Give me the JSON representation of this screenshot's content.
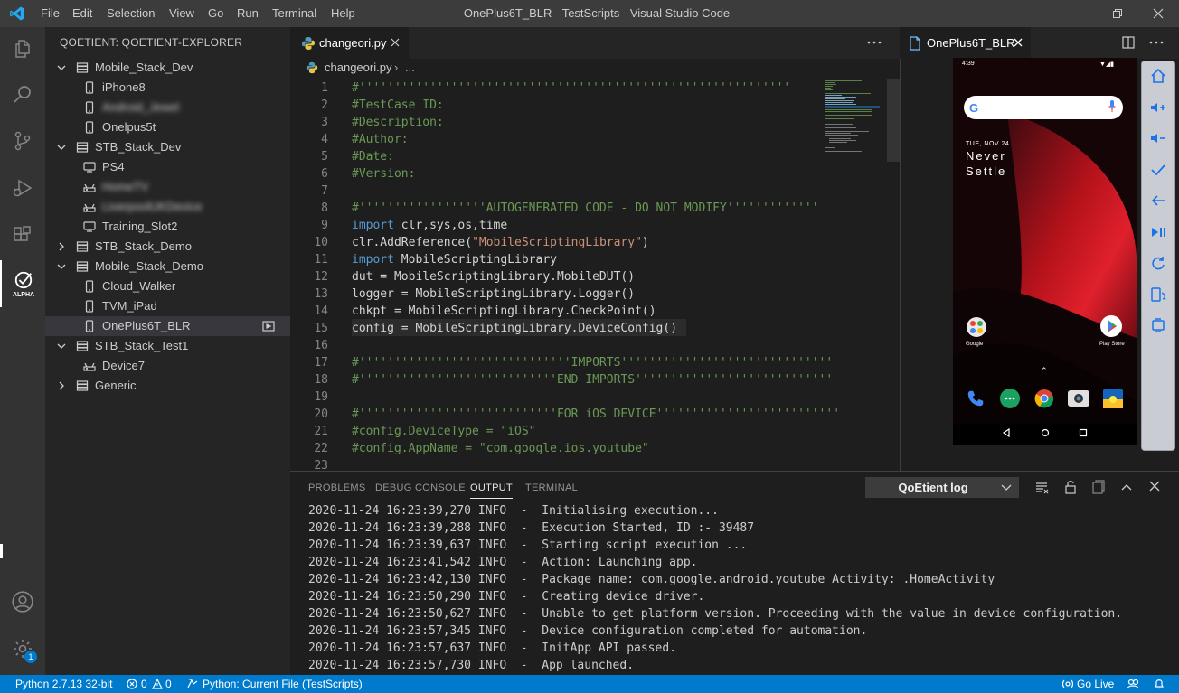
{
  "window": {
    "title": "OnePlus6T_BLR - TestScripts - Visual Studio Code",
    "menu": [
      "File",
      "Edit",
      "Selection",
      "View",
      "Go",
      "Run",
      "Terminal",
      "Help"
    ]
  },
  "activity": {
    "items": [
      "files-icon",
      "search-icon",
      "source-control-icon",
      "run-debug-icon",
      "extensions-icon",
      "qoetient-icon"
    ],
    "qoetient_badge": "ALPHA",
    "settings_badge": "1"
  },
  "sidebar": {
    "header": "QOETIENT: QOETIENT-EXPLORER",
    "tree": [
      {
        "label": "Mobile_Stack_Dev",
        "level": 0,
        "expanded": true,
        "icon": "server-icon"
      },
      {
        "label": "iPhone8",
        "level": 1,
        "icon": "phone-icon"
      },
      {
        "label": "Android_Jewel",
        "level": 1,
        "icon": "phone-icon",
        "blurred": true
      },
      {
        "label": "Onelpus5t",
        "level": 1,
        "icon": "phone-icon"
      },
      {
        "label": "STB_Stack_Dev",
        "level": 0,
        "expanded": true,
        "icon": "server-icon"
      },
      {
        "label": "PS4",
        "level": 1,
        "icon": "tv-icon"
      },
      {
        "label": "HomeTV",
        "level": 1,
        "icon": "router-icon",
        "blurred": true
      },
      {
        "label": "LiverpoolUKDevice",
        "level": 1,
        "icon": "router-icon",
        "blurred": true
      },
      {
        "label": "Training_Slot2",
        "level": 1,
        "icon": "tv-icon"
      },
      {
        "label": "STB_Stack_Demo",
        "level": 0,
        "expanded": false,
        "icon": "server-icon"
      },
      {
        "label": "Mobile_Stack_Demo",
        "level": 0,
        "expanded": true,
        "icon": "server-icon"
      },
      {
        "label": "Cloud_Walker",
        "level": 1,
        "icon": "phone-icon"
      },
      {
        "label": "TVM_iPad",
        "level": 1,
        "icon": "phone-icon"
      },
      {
        "label": "OnePlus6T_BLR",
        "level": 1,
        "icon": "phone-icon",
        "selected": true
      },
      {
        "label": "STB_Stack_Test1",
        "level": 0,
        "expanded": true,
        "icon": "server-icon"
      },
      {
        "label": "Device7",
        "level": 1,
        "icon": "router-icon"
      },
      {
        "label": "Generic",
        "level": 0,
        "expanded": false,
        "icon": "server-icon"
      }
    ]
  },
  "editor": {
    "tab_label": "changeori.py",
    "breadcrumb_file": "changeori.py",
    "breadcrumb_more": "...",
    "lines": [
      {
        "n": "1",
        "t": "#'''''''''''''''''''''''''''''''''''''''''''''''''''''''''''''",
        "k": "comment"
      },
      {
        "n": "2",
        "t": "#TestCase ID:",
        "k": "comment"
      },
      {
        "n": "3",
        "t": "#Description:",
        "k": "comment"
      },
      {
        "n": "4",
        "t": "#Author:",
        "k": "comment"
      },
      {
        "n": "5",
        "t": "#Date:",
        "k": "comment"
      },
      {
        "n": "6",
        "t": "#Version:",
        "k": "comment"
      },
      {
        "n": "7",
        "t": "",
        "k": "plain"
      },
      {
        "n": "8",
        "t": "#''''''''''''''''''AUTOGENERATED CODE - DO NOT MODIFY'''''''''''''",
        "k": "comment"
      },
      {
        "n": "9",
        "t": "import clr,sys,os,time",
        "k": "import"
      },
      {
        "n": "10",
        "t": "clr.AddReference(\"MobileScriptingLibrary\")",
        "k": "ref"
      },
      {
        "n": "11",
        "t": "import MobileScriptingLibrary",
        "k": "import"
      },
      {
        "n": "12",
        "t": "dut = MobileScriptingLibrary.MobileDUT()",
        "k": "plain"
      },
      {
        "n": "13",
        "t": "logger = MobileScriptingLibrary.Logger()",
        "k": "plain"
      },
      {
        "n": "14",
        "t": "chkpt = MobileScriptingLibrary.CheckPoint()",
        "k": "plain"
      },
      {
        "n": "15",
        "t": "config = MobileScriptingLibrary.DeviceConfig()",
        "k": "plain"
      },
      {
        "n": "16",
        "t": "",
        "k": "plain"
      },
      {
        "n": "17",
        "t": "#''''''''''''''''''''''''''''''IMPORTS''''''''''''''''''''''''''''''",
        "k": "comment"
      },
      {
        "n": "18",
        "t": "#''''''''''''''''''''''''''''END IMPORTS''''''''''''''''''''''''''''",
        "k": "comment"
      },
      {
        "n": "19",
        "t": "",
        "k": "plain"
      },
      {
        "n": "20",
        "t": "#''''''''''''''''''''''''''''FOR iOS DEVICE''''''''''''''''''''''''''",
        "k": "comment"
      },
      {
        "n": "21",
        "t": "#config.DeviceType = \"iOS\"",
        "k": "comment"
      },
      {
        "n": "22",
        "t": "#config.AppName = \"com.google.ios.youtube\"",
        "k": "comment"
      },
      {
        "n": "23",
        "t": "",
        "k": "plain"
      }
    ]
  },
  "device_panel": {
    "tab_label": "OnePlus6T_BLR",
    "phone": {
      "status_time": "4:39",
      "date": "TUE, NOV 24",
      "wallpaper_text_1": "Never",
      "wallpaper_text_2": "Settle",
      "google_app_label": "Google",
      "play_store_label": "Play Store"
    },
    "controls": [
      "home-icon",
      "volume-up-icon",
      "volume-down-icon",
      "check-icon",
      "back-icon",
      "play-pause-icon",
      "refresh-icon",
      "rotate-icon",
      "screenshot-icon"
    ]
  },
  "panel": {
    "tabs": [
      "PROBLEMS",
      "DEBUG CONSOLE",
      "OUTPUT",
      "TERMINAL"
    ],
    "active_tab": "OUTPUT",
    "channel": "QoEtient log",
    "log": [
      "2020-11-24 16:23:39,270 INFO  -  Initialising execution...",
      "2020-11-24 16:23:39,288 INFO  -  Execution Started, ID :- 39487",
      "2020-11-24 16:23:39,637 INFO  -  Starting script execution ...",
      "2020-11-24 16:23:41,542 INFO  -  Action: Launching app.",
      "2020-11-24 16:23:42,130 INFO  -  Package name: com.google.android.youtube Activity: .HomeActivity",
      "2020-11-24 16:23:50,290 INFO  -  Creating device driver.",
      "2020-11-24 16:23:50,627 INFO  -  Unable to get platform version. Proceeding with the value in device configuration.",
      "2020-11-24 16:23:57,345 INFO  -  Device configuration completed for automation.",
      "2020-11-24 16:23:57,637 INFO  -  InitApp API passed.",
      "2020-11-24 16:23:57,730 INFO  -  App launched."
    ]
  },
  "status": {
    "python": "Python 2.7.13 32-bit",
    "errors": "0",
    "warnings": "0",
    "run": "Python: Current File (TestScripts)",
    "go_live": "Go Live"
  },
  "colors": {
    "accent": "#007acc",
    "editor_bg": "#1e1e1e",
    "sidebar_bg": "#252526",
    "activity_bg": "#333333"
  }
}
